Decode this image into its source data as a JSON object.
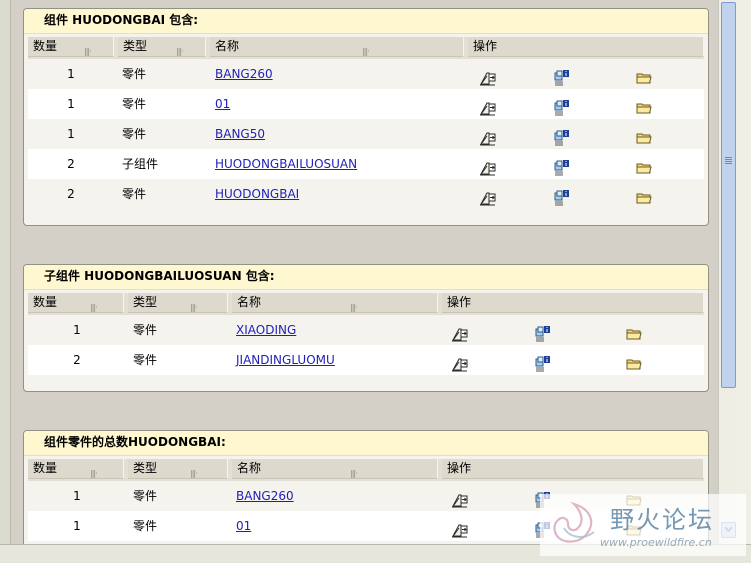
{
  "headers": {
    "qty": "数量",
    "type": "类型",
    "name": "名称",
    "ops": "操作"
  },
  "panel1": {
    "title": "组件 HUODONGBAI 包含:",
    "rows": [
      {
        "qty": "1",
        "type": "零件",
        "name": "BANG260"
      },
      {
        "qty": "1",
        "type": "零件",
        "name": "01"
      },
      {
        "qty": "1",
        "type": "零件",
        "name": "BANG50"
      },
      {
        "qty": "2",
        "type": "子组件",
        "name": "HUODONGBAILUOSUAN"
      },
      {
        "qty": "2",
        "type": "零件",
        "name": "HUODONGBAI"
      }
    ]
  },
  "panel2": {
    "title": "子组件 HUODONGBAILUOSUAN 包含:",
    "rows": [
      {
        "qty": "1",
        "type": "零件",
        "name": "XIAODING"
      },
      {
        "qty": "2",
        "type": "零件",
        "name": "JIANDINGLUOMU"
      }
    ]
  },
  "panel3": {
    "title": "组件零件的总数HUODONGBAI:",
    "rows": [
      {
        "qty": "1",
        "type": "零件",
        "name": "BANG260"
      },
      {
        "qty": "1",
        "type": "零件",
        "name": "01"
      }
    ]
  },
  "action_icons": [
    "edit-arrow-icon",
    "copy-info-icon",
    "folder-icon"
  ],
  "watermark": {
    "text": "野火论坛",
    "url": "www.proewildfire.cn"
  },
  "colors": {
    "panel_header": "#fff7cf",
    "link": "#1f1fb8",
    "scroll_thumb": "#c1d2ee",
    "grey_bg": "#d4d0c8"
  }
}
